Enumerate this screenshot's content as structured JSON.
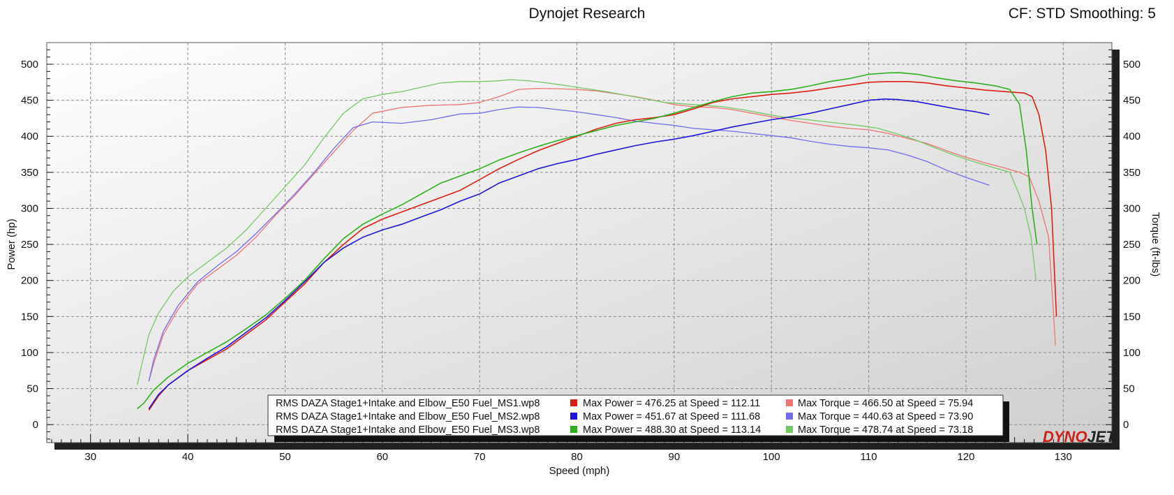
{
  "header": {
    "title": "Dynojet Research",
    "correction": "CF: STD Smoothing: 5"
  },
  "chart_data": {
    "type": "line",
    "xlabel": "Speed (mph)",
    "ylabel": "Power (hp)",
    "y2label": "Torque (ft-lbs)",
    "xlim": [
      25.5,
      135
    ],
    "ylim": [
      -25,
      530
    ],
    "x_ticks": [
      "30",
      "40",
      "50",
      "60",
      "70",
      "80",
      "90",
      "100",
      "110",
      "120",
      "130"
    ],
    "y_ticks": [
      "0",
      "50",
      "100",
      "150",
      "200",
      "250",
      "300",
      "350",
      "400",
      "450",
      "500"
    ],
    "grid": true,
    "legend_position": "bottom-center",
    "brand": "DYNOJET",
    "colors": {
      "power": [
        "#dd1d10",
        "#1c14dc",
        "#2cb01a"
      ],
      "torque": [
        "#f07373",
        "#6f6cf0",
        "#72c962"
      ]
    },
    "legend": [
      {
        "file": "RMS DAZA Stage1+Intake and Elbow_E50 Fuel_MS1.wp8",
        "power_text": "Max Power = 476.25 at Speed = 112.11",
        "torque_text": "Max Torque = 466.50 at Speed = 75.94"
      },
      {
        "file": "RMS DAZA Stage1+Intake and Elbow_E50 Fuel_MS2.wp8",
        "power_text": "Max Power = 451.67 at Speed = 111.68",
        "torque_text": "Max Torque = 440.63 at Speed = 73.90"
      },
      {
        "file": "RMS DAZA Stage1+Intake and Elbow_E50 Fuel_MS3.wp8",
        "power_text": "Max Power = 488.30 at Speed = 113.14",
        "torque_text": "Max Torque = 478.74 at Speed = 73.18"
      }
    ],
    "series": [
      {
        "name": "RMS DAZA Stage1+Intake and Elbow_E50 Fuel_MS1.wp8",
        "kind": "power",
        "x": [
          36.0,
          37,
          38,
          40,
          42,
          44,
          46,
          48,
          50,
          52,
          54,
          56,
          58,
          60,
          62,
          64,
          66,
          68,
          70,
          72,
          74,
          76,
          78,
          80,
          82,
          84,
          86,
          88,
          90,
          92,
          94,
          96,
          98,
          100,
          102,
          104,
          106,
          108,
          110,
          112,
          114,
          116,
          118,
          120,
          122,
          124,
          126,
          126.8,
          127.5,
          128.2,
          128.8,
          129.3
        ],
        "y": [
          20,
          40,
          55,
          75,
          90,
          105,
          125,
          145,
          170,
          195,
          225,
          250,
          272,
          285,
          295,
          305,
          315,
          325,
          340,
          355,
          368,
          380,
          390,
          400,
          410,
          418,
          423,
          426,
          430,
          438,
          447,
          452,
          455,
          458,
          460,
          463,
          467,
          471,
          475,
          476,
          476,
          474,
          470,
          467,
          464,
          462,
          460,
          455,
          430,
          380,
          300,
          150
        ]
      },
      {
        "name": "RMS DAZA Stage1+Intake and Elbow_E50 Fuel_MS2.wp8",
        "kind": "power",
        "x": [
          36.0,
          37,
          38,
          40,
          42,
          44,
          46,
          48,
          50,
          52,
          54,
          56,
          58,
          60,
          62,
          64,
          66,
          68,
          70,
          72,
          74,
          76,
          78,
          80,
          82,
          84,
          86,
          88,
          90,
          92,
          94,
          96,
          98,
          100,
          102,
          104,
          106,
          108,
          110,
          111.68,
          113,
          115,
          117,
          119,
          121,
          122.4
        ],
        "y": [
          22,
          42,
          55,
          75,
          92,
          108,
          128,
          148,
          172,
          198,
          225,
          245,
          260,
          270,
          278,
          288,
          298,
          310,
          320,
          335,
          345,
          355,
          362,
          368,
          375,
          381,
          387,
          392,
          396,
          401,
          407,
          413,
          418,
          423,
          427,
          432,
          438,
          444,
          450,
          451.7,
          451,
          448,
          443,
          438,
          434,
          430
        ]
      },
      {
        "name": "RMS DAZA Stage1+Intake and Elbow_E50 Fuel_MS3.wp8",
        "kind": "power",
        "x": [
          34.8,
          35.5,
          36.5,
          38,
          40,
          42,
          44,
          46,
          48,
          50,
          52,
          54,
          56,
          58,
          60,
          62,
          64,
          66,
          68,
          70,
          72,
          74,
          76,
          78,
          80,
          82,
          84,
          86,
          88,
          90,
          92,
          94,
          96,
          98,
          100,
          102,
          104,
          106,
          108,
          110,
          112,
          113.14,
          115,
          117,
          119,
          121,
          123,
          124.5,
          125.5,
          126.2,
          126.8,
          127.3
        ],
        "y": [
          22,
          30,
          48,
          66,
          85,
          100,
          115,
          133,
          152,
          175,
          200,
          230,
          258,
          278,
          292,
          305,
          320,
          335,
          345,
          355,
          367,
          377,
          386,
          394,
          401,
          408,
          415,
          420,
          425,
          432,
          440,
          448,
          455,
          460,
          462,
          465,
          470,
          476,
          480,
          486,
          488,
          488.3,
          486,
          481,
          477,
          474,
          470,
          465,
          445,
          380,
          300,
          250
        ]
      },
      {
        "name": "RMS DAZA Stage1+Intake and Elbow_E50 Fuel_MS1.wp8",
        "kind": "torque",
        "x": [
          36.0,
          36.5,
          37.5,
          39,
          41,
          43,
          45,
          47,
          49,
          51,
          53,
          55,
          57,
          59,
          62,
          65,
          68,
          70,
          72,
          74,
          75.94,
          78,
          80,
          82,
          84,
          86,
          88,
          90,
          92,
          94,
          96,
          98,
          100,
          102,
          104,
          106,
          108,
          110,
          112,
          114,
          116,
          118,
          120,
          122,
          124,
          125.5,
          126.5,
          127.5,
          128.5,
          129.2
        ],
        "y": [
          60,
          85,
          125,
          160,
          195,
          215,
          235,
          260,
          290,
          318,
          348,
          378,
          408,
          432,
          440,
          443,
          444,
          447,
          455,
          465,
          466.5,
          466,
          465,
          463,
          459,
          455,
          450,
          444,
          441,
          440,
          437,
          432,
          427,
          422,
          418,
          414,
          411,
          409,
          404,
          397,
          390,
          380,
          371,
          363,
          356,
          350,
          344,
          310,
          260,
          110
        ]
      },
      {
        "name": "RMS DAZA Stage1+Intake and Elbow_E50 Fuel_MS2.wp8",
        "kind": "torque",
        "x": [
          36.0,
          36.5,
          37.5,
          39,
          41,
          43,
          45,
          47,
          49,
          51,
          53,
          55,
          57,
          59,
          62,
          65,
          68,
          70,
          72,
          73.9,
          76,
          78,
          80,
          82,
          84,
          86,
          88,
          90,
          92,
          94,
          96,
          98,
          100,
          102,
          104,
          106,
          108,
          110,
          112,
          114,
          116,
          118,
          120,
          122.4
        ],
        "y": [
          60,
          90,
          130,
          165,
          198,
          220,
          240,
          265,
          292,
          320,
          350,
          383,
          412,
          420,
          418,
          423,
          431,
          432,
          437,
          440.6,
          440,
          437,
          434,
          430,
          426,
          421,
          418,
          415,
          411,
          409,
          407,
          404,
          401,
          398,
          393,
          389,
          386,
          384,
          381,
          374,
          365,
          353,
          343,
          332
        ]
      },
      {
        "name": "RMS DAZA Stage1+Intake and Elbow_E50 Fuel_MS3.wp8",
        "kind": "torque",
        "x": [
          34.8,
          35.3,
          36,
          37,
          38.5,
          40,
          42,
          44,
          46,
          48,
          50,
          52,
          54,
          56,
          58,
          60,
          62,
          64,
          66,
          68,
          70,
          72,
          73.18,
          75,
          77,
          79,
          81,
          83,
          85,
          87,
          89,
          91,
          93,
          95,
          97,
          99,
          101,
          103,
          105,
          107,
          109,
          111,
          113,
          115,
          117,
          119,
          121,
          123,
          124.5,
          125.3,
          126,
          126.7,
          127.2
        ],
        "y": [
          55,
          85,
          125,
          155,
          185,
          205,
          225,
          245,
          270,
          300,
          330,
          360,
          398,
          432,
          452,
          458,
          462,
          468,
          474,
          476,
          476,
          477,
          478.7,
          477,
          474,
          470,
          466,
          462,
          457,
          452,
          447,
          445,
          443,
          441,
          437,
          432,
          427,
          424,
          421,
          418,
          415,
          411,
          403,
          394,
          383,
          373,
          364,
          356,
          350,
          325,
          300,
          260,
          200
        ]
      }
    ]
  }
}
